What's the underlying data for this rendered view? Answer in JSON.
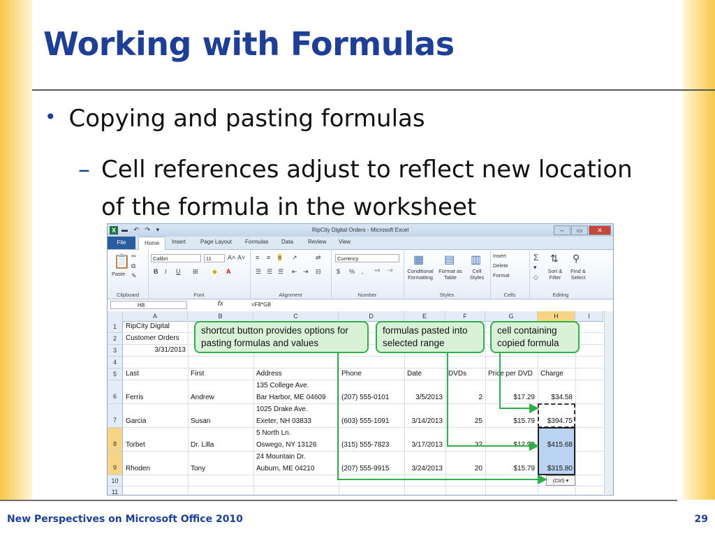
{
  "slide": {
    "title": "Working with Formulas",
    "bullet1": "Copying and pasting formulas",
    "bullet2_dash": "–",
    "bullet2": "Cell references adjust to reflect new location of the formula in the worksheet",
    "footer_left": "New Perspectives on Microsoft Office 2010",
    "page_number": "29"
  },
  "excel": {
    "window_title": "RipCity Digital Orders - Microsoft Excel",
    "app_icon": "X",
    "quick_access": "▬ ↶ ↷ ▾",
    "window_buttons": [
      "–",
      "▭",
      "✕"
    ],
    "tabs": [
      "File",
      "Home",
      "Insert",
      "Page Layout",
      "Formulas",
      "Data",
      "Review",
      "View"
    ],
    "active_tab": "Home",
    "ribbon": {
      "clipboard": {
        "label": "Clipboard",
        "paste": "Paste"
      },
      "font": {
        "label": "Font",
        "name": "Calibri",
        "size": "11",
        "grow": "A˄",
        "shrink": "A˅",
        "bold": "B",
        "italic": "I",
        "underline": "U"
      },
      "alignment": {
        "label": "Alignment"
      },
      "number": {
        "label": "Number",
        "format": "Currency",
        "dollar": "$",
        "percent": "%",
        "comma": ","
      },
      "styles": {
        "label": "Styles",
        "conditional": "Conditional Formatting",
        "format_table": "Format as Table",
        "cell_styles": "Cell Styles"
      },
      "cells": {
        "label": "Cells",
        "insert": "Insert",
        "delete": "Delete",
        "format": "Format"
      },
      "editing": {
        "label": "Editing",
        "sum": "Σ",
        "sort": "Sort & Filter",
        "find": "Find & Select"
      }
    },
    "name_box": "H8",
    "fx": "fx",
    "formula": "=F8*G8",
    "columns": [
      "A",
      "B",
      "C",
      "D",
      "E",
      "F",
      "G",
      "H",
      "I"
    ],
    "row_numbers": [
      "1",
      "2",
      "3",
      "4",
      "5",
      "6",
      "7",
      "8",
      "9",
      "10",
      "11"
    ],
    "rows": {
      "r1": {
        "a": "RipCity Digital"
      },
      "r2": {
        "a": "Customer Orders"
      },
      "r3": {
        "a": "3/31/2013"
      },
      "r5": {
        "a": "Last",
        "b": "First",
        "c": "Address",
        "d": "Phone",
        "e": "Date",
        "f": "DVDs",
        "g": "Price per DVD",
        "h": "Charge"
      },
      "r6": {
        "a": "Ferris",
        "b": "Andrew",
        "c1": "135 College Ave.",
        "c2": "Bar Harbor, ME 04609",
        "d": "(207) 555-0101",
        "e": "3/5/2013",
        "f": "2",
        "g": "$17.29",
        "h": "$34.58"
      },
      "r7": {
        "a": "Garcia",
        "b": "Susan",
        "c1": "1025 Drake Ave.",
        "c2": "Exeter, NH 03833",
        "d": "(603) 555-1091",
        "e": "3/14/2013",
        "f": "25",
        "g": "$15.79",
        "h": "$394.75"
      },
      "r8": {
        "a": "Torbet",
        "b": "Dr. Lilla",
        "c1": "5 North Ln.",
        "c2": "Oswego, NY 13126",
        "d": "(315) 555-7823",
        "e": "3/17/2013",
        "f": "32",
        "g": "$12.99",
        "h": "$415.68"
      },
      "r9": {
        "a": "Rhoden",
        "b": "Tony",
        "c1": "24 Mountain Dr.",
        "c2": "Auburn, ME 04210",
        "d": "(207) 555-9915",
        "e": "3/24/2013",
        "f": "20",
        "g": "$15.79",
        "h": "$315.80"
      }
    },
    "paste_options": "(Ctrl) ▾",
    "callouts": {
      "shortcut": "shortcut button provides options for pasting formulas and values",
      "pasted": "formulas pasted into selected range",
      "copied": "cell containing copied formula"
    },
    "callout_color": "#2fae4a"
  }
}
